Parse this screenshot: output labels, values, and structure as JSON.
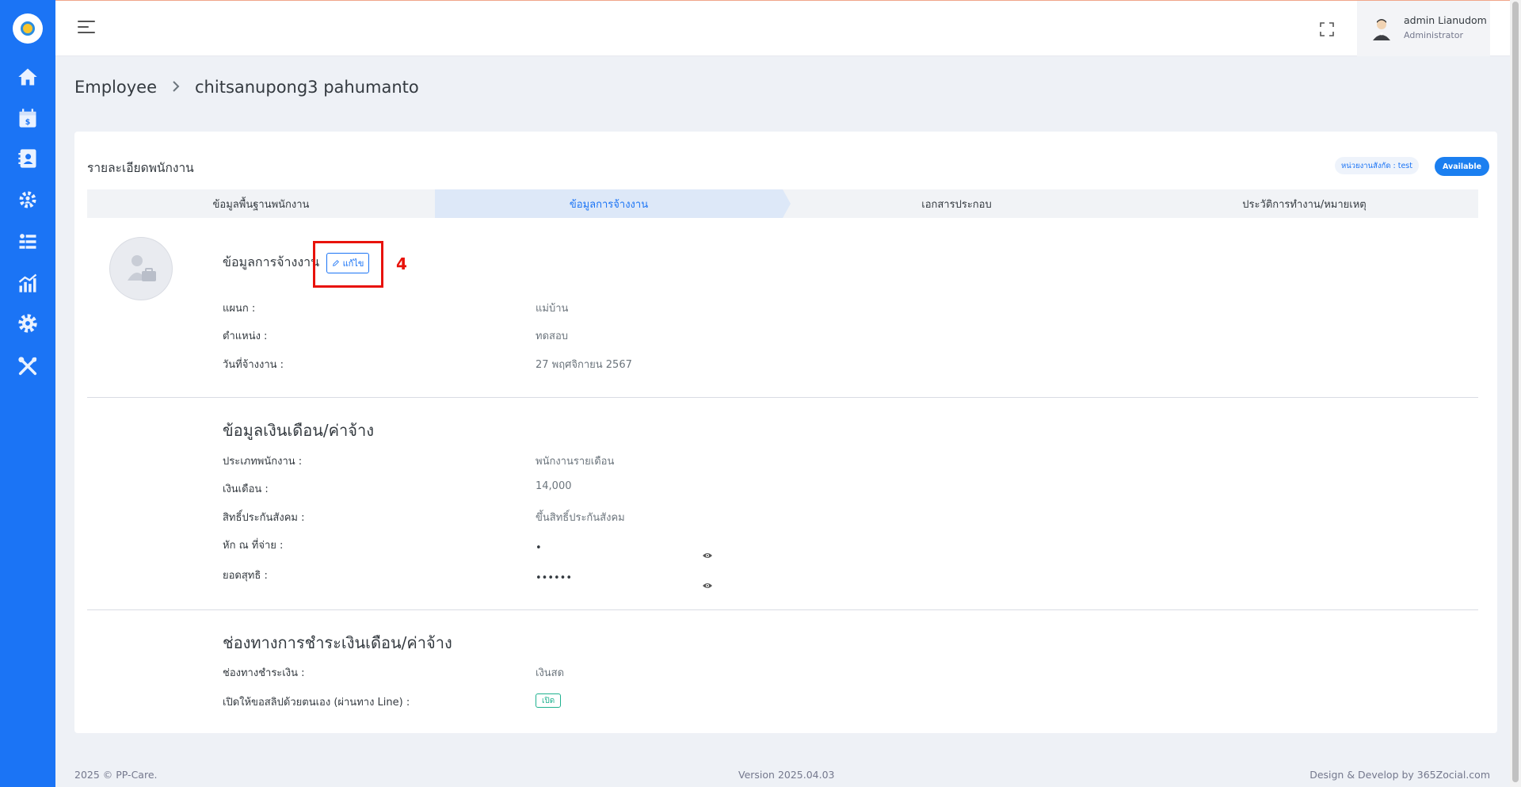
{
  "header": {
    "user_name": "admin Lianudom",
    "user_role": "Administrator"
  },
  "sidebar": {
    "icons": [
      "home-icon",
      "calendar-payroll-icon",
      "contact-card-icon",
      "team-settings-icon",
      "list-icon",
      "chart-icon",
      "gear-icon",
      "tools-icon"
    ]
  },
  "breadcrumb": {
    "root": "Employee",
    "current": "chitsanupong3 pahumanto"
  },
  "card": {
    "title": "รายละเอียดพนักงาน",
    "unit_badge": "หน่วยงานสังกัด : test",
    "status_badge": "Available"
  },
  "tabs": [
    {
      "label": "ข้อมูลพื้นฐานพนักงาน",
      "active": false
    },
    {
      "label": "ข้อมูลการจ้างงาน",
      "active": true
    },
    {
      "label": "เอกสารประกอบ",
      "active": false
    },
    {
      "label": "ประวัติการทำงาน/หมายเหตุ",
      "active": false
    }
  ],
  "employment": {
    "title": "ข้อมูลการจ้างงาน",
    "edit_label": "แก้ไข",
    "marker": "4",
    "fields": [
      {
        "label": "แผนก :",
        "value": "แม่บ้าน"
      },
      {
        "label": "ตำแหน่ง :",
        "value": "ทดสอบ"
      },
      {
        "label": "วันที่จ้างงาน :",
        "value": "27 พฤศจิกายน 2567"
      }
    ]
  },
  "salary": {
    "title": "ข้อมูลเงินเดือน/ค่าจ้าง",
    "fields": [
      {
        "label": "ประเภทพนักงาน :",
        "value": "พนักงานรายเดือน"
      },
      {
        "label": "เงินเดือน :",
        "value": "14,000"
      },
      {
        "label": "สิทธิ์ประกันสังคม :",
        "value": "ขึ้นสิทธิ์ประกันสังคม"
      },
      {
        "label": "หัก ณ ที่จ่าย :",
        "value": "•"
      },
      {
        "label": "ยอดสุทธิ :",
        "value": "••••••"
      }
    ]
  },
  "payment": {
    "title": "ช่องทางการชำระเงินเดือน/ค่าจ้าง",
    "fields": [
      {
        "label": "ช่องทางชำระเงิน :",
        "value": "เงินสด"
      },
      {
        "label": "เปิดให้ขอสลิปด้วยตนเอง (ผ่านทาง Line) :",
        "value": "เปิด"
      }
    ]
  },
  "footer": {
    "copyright": "2025 © PP-Care.",
    "version": "Version 2025.04.03",
    "credit": "Design & Develop by 365Zocial.com"
  },
  "colors": {
    "sidebar": "#1b74f5",
    "accent": "#1b74f5",
    "highlight": "#e8120a",
    "success": "#1fb18f"
  }
}
